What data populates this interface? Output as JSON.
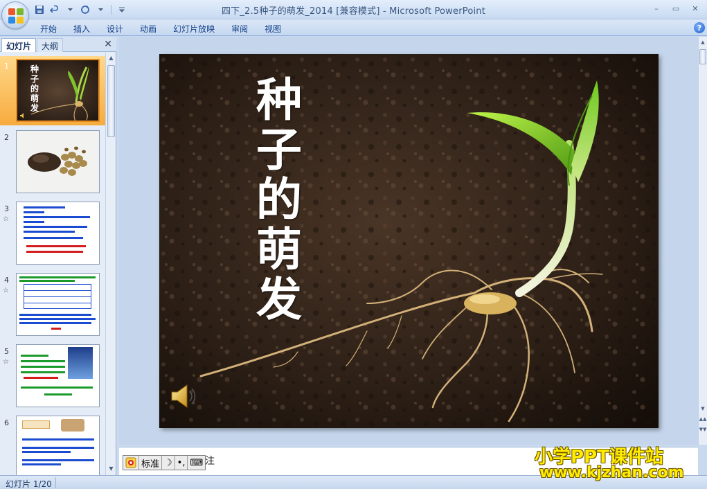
{
  "window": {
    "title": "四下_2.5种子的萌发_2014 [兼容模式]",
    "separator": " - ",
    "app_name": "Microsoft PowerPoint",
    "buttons": {
      "minimize": "–",
      "restore": "▭",
      "close": "✕"
    }
  },
  "ribbon": {
    "tabs": [
      "开始",
      "插入",
      "设计",
      "动画",
      "幻灯片放映",
      "审阅",
      "视图"
    ],
    "help": "?"
  },
  "left_panel": {
    "tabs": {
      "slides": "幻灯片",
      "outline": "大纲"
    },
    "close": "✕",
    "thumbnails": [
      {
        "num": "1",
        "title": "种子的萌发",
        "has_star": false
      },
      {
        "num": "2",
        "has_star": false
      },
      {
        "num": "3",
        "has_star": true
      },
      {
        "num": "4",
        "has_star": true
      },
      {
        "num": "5",
        "has_star": true
      },
      {
        "num": "6",
        "has_star": false
      },
      {
        "num": "",
        "has_star": false
      }
    ],
    "thumb3_lines": [
      "种子萌发需要哪些条件",
      "一、提出问题",
      "种子萌发需要什么样的外部条件？",
      "二、作出假设",
      "种子萌发需要适宜的温度、水和空气",
      "三、设计实验"
    ],
    "thumb6_title": "观察种子萌发"
  },
  "slide": {
    "title_chars": [
      "种",
      "子",
      "的",
      "萌",
      "发"
    ]
  },
  "notes": {
    "text": "注",
    "ime": [
      "标准",
      "☽",
      "•,",
      "⌨"
    ]
  },
  "watermark": {
    "line1": "小学PPT课件站",
    "line2": "www.kjzhan.com"
  },
  "status": {
    "slide_indicator": "幻灯片 1/20"
  },
  "colors": {
    "accent": "#15428b",
    "selection": "#f7ab3e",
    "soil": "#2a1d14",
    "sprout": "#8fd12a"
  }
}
